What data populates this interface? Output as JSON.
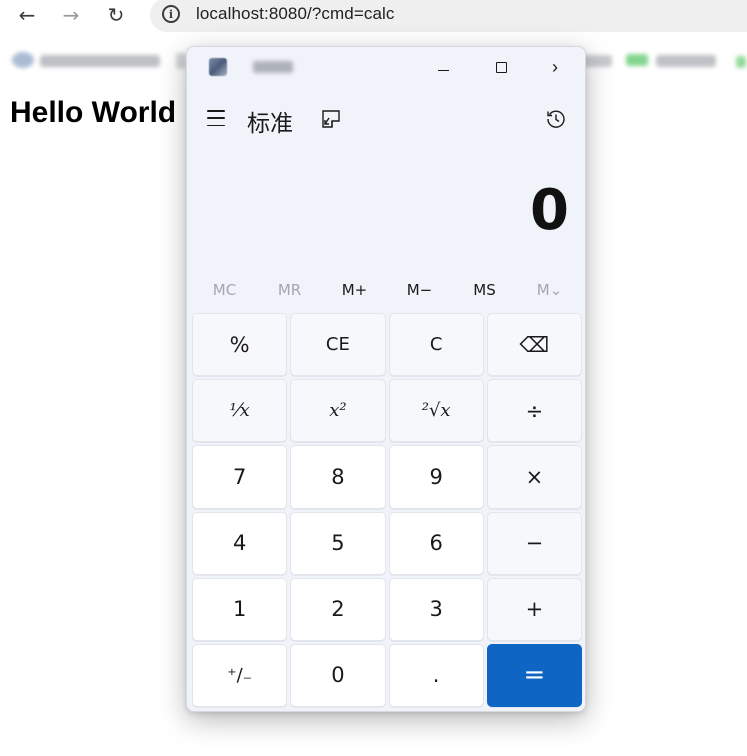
{
  "browser": {
    "back_icon": "←",
    "forward_icon": "→",
    "reload_icon": "↻",
    "info_icon": "i",
    "url": "localhost:8080/?cmd=calc"
  },
  "page": {
    "heading": "Hello World"
  },
  "calculator": {
    "mode_title": "标准",
    "display_value": "0",
    "window_controls": {
      "close_icon": "›"
    },
    "memory": [
      "MC",
      "MR",
      "M+",
      "M−",
      "MS",
      "M⌄"
    ],
    "keys": [
      {
        "label": "%",
        "kind": "op"
      },
      {
        "label": "CE",
        "kind": "op"
      },
      {
        "label": "C",
        "kind": "op"
      },
      {
        "label": "⌫",
        "kind": "op"
      },
      {
        "label": "⅟x",
        "kind": "op"
      },
      {
        "label": "x²",
        "kind": "op"
      },
      {
        "label": "²√x",
        "kind": "op"
      },
      {
        "label": "÷",
        "kind": "op"
      },
      {
        "label": "7",
        "kind": "num"
      },
      {
        "label": "8",
        "kind": "num"
      },
      {
        "label": "9",
        "kind": "num"
      },
      {
        "label": "×",
        "kind": "op"
      },
      {
        "label": "4",
        "kind": "num"
      },
      {
        "label": "5",
        "kind": "num"
      },
      {
        "label": "6",
        "kind": "num"
      },
      {
        "label": "−",
        "kind": "op"
      },
      {
        "label": "1",
        "kind": "num"
      },
      {
        "label": "2",
        "kind": "num"
      },
      {
        "label": "3",
        "kind": "num"
      },
      {
        "label": "+",
        "kind": "op"
      },
      {
        "label": "⁺∕₋",
        "kind": "num"
      },
      {
        "label": "0",
        "kind": "num"
      },
      {
        "label": ".",
        "kind": "num"
      },
      {
        "label": "=",
        "kind": "equals"
      }
    ],
    "accent_color": "#0f65c4"
  }
}
